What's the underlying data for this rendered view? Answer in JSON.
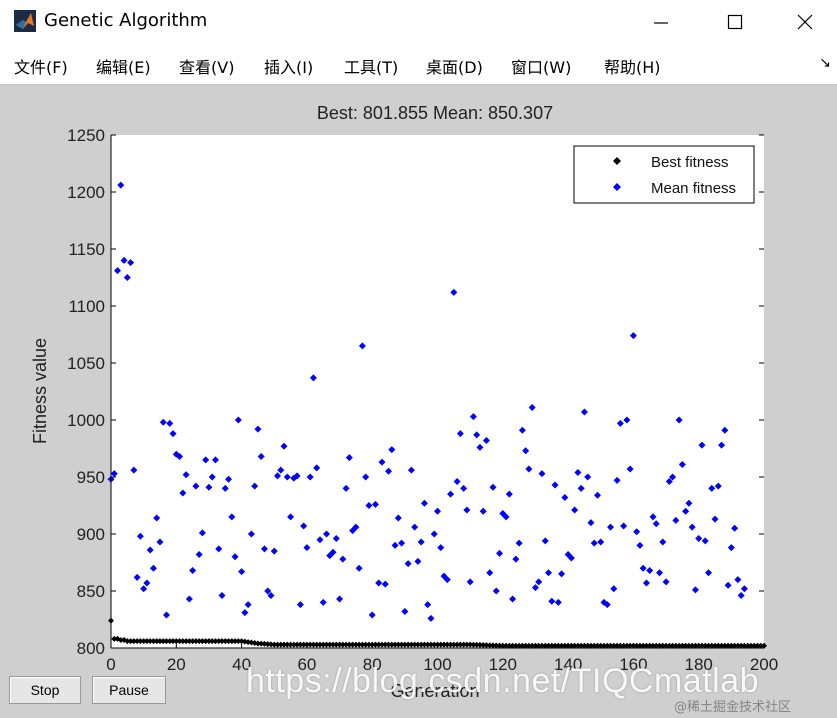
{
  "window": {
    "title": "Genetic Algorithm",
    "minimize_glyph": "—",
    "maximize_glyph": "☐",
    "close_glyph": "✕"
  },
  "menu": {
    "items": [
      {
        "label": "文件(F)"
      },
      {
        "label": "编辑(E)"
      },
      {
        "label": "查看(V)"
      },
      {
        "label": "插入(I)"
      },
      {
        "label": "工具(T)"
      },
      {
        "label": "桌面(D)"
      },
      {
        "label": "窗口(W)"
      },
      {
        "label": "帮助(H)"
      }
    ],
    "dock_glyph": "↘"
  },
  "buttons": {
    "stop": "Stop",
    "pause": "Pause"
  },
  "watermark": {
    "url": "https://blog.csdn.net/TIQCmatlab",
    "community": "@稀土掘金技术社区"
  },
  "colors": {
    "best": "#000000",
    "mean": "#0000ff",
    "figure_bg": "#cfcfcf",
    "axes_bg": "#ffffff"
  },
  "chart_data": {
    "type": "scatter",
    "title": "Best: 801.855 Mean: 850.307",
    "xlabel": "Generation",
    "ylabel": "Fitness value",
    "xlim": [
      0,
      200
    ],
    "ylim": [
      800,
      1250
    ],
    "xticks": [
      0,
      20,
      40,
      60,
      80,
      100,
      120,
      140,
      160,
      180,
      200
    ],
    "yticks": [
      800,
      850,
      900,
      950,
      1000,
      1050,
      1100,
      1150,
      1200,
      1250
    ],
    "legend": {
      "placement": "top-right",
      "entries": [
        "Best fitness",
        "Mean fitness"
      ]
    },
    "series": [
      {
        "name": "Best fitness",
        "marker": "diamond",
        "x": [
          0,
          1,
          2,
          3,
          4,
          5,
          6,
          7,
          8,
          9,
          10,
          12,
          14,
          16,
          18,
          20,
          25,
          30,
          35,
          40,
          45,
          50,
          60,
          70,
          80,
          90,
          100,
          110,
          120,
          130,
          140,
          150,
          160,
          170,
          180,
          190,
          200
        ],
        "values": [
          824,
          808,
          808,
          807,
          807,
          806,
          806,
          806,
          806,
          806,
          806,
          806,
          806,
          806,
          806,
          806,
          806,
          806,
          806,
          806,
          804,
          803,
          803,
          803,
          803,
          803,
          803,
          803,
          802,
          802,
          802,
          802,
          802,
          802,
          802,
          802,
          802
        ]
      },
      {
        "name": "Mean fitness",
        "marker": "diamond",
        "points": [
          [
            0,
            948
          ],
          [
            1,
            953
          ],
          [
            2,
            1131
          ],
          [
            3,
            1206
          ],
          [
            4,
            1140
          ],
          [
            5,
            1125
          ],
          [
            6,
            1138
          ],
          [
            7,
            956
          ],
          [
            8,
            862
          ],
          [
            9,
            898
          ],
          [
            10,
            852
          ],
          [
            11,
            857
          ],
          [
            12,
            886
          ],
          [
            13,
            870
          ],
          [
            14,
            914
          ],
          [
            15,
            893
          ],
          [
            16,
            998
          ],
          [
            17,
            829
          ],
          [
            18,
            997
          ],
          [
            19,
            988
          ],
          [
            20,
            970
          ],
          [
            21,
            968
          ],
          [
            22,
            936
          ],
          [
            23,
            952
          ],
          [
            24,
            843
          ],
          [
            25,
            868
          ],
          [
            26,
            942
          ],
          [
            27,
            882
          ],
          [
            28,
            901
          ],
          [
            29,
            965
          ],
          [
            30,
            941
          ],
          [
            31,
            950
          ],
          [
            32,
            965
          ],
          [
            33,
            887
          ],
          [
            34,
            846
          ],
          [
            35,
            940
          ],
          [
            36,
            948
          ],
          [
            37,
            915
          ],
          [
            38,
            880
          ],
          [
            39,
            1000
          ],
          [
            40,
            867
          ],
          [
            41,
            831
          ],
          [
            42,
            838
          ],
          [
            43,
            900
          ],
          [
            44,
            942
          ],
          [
            45,
            992
          ],
          [
            46,
            968
          ],
          [
            47,
            887
          ],
          [
            48,
            850
          ],
          [
            49,
            846
          ],
          [
            50,
            885
          ],
          [
            51,
            951
          ],
          [
            52,
            956
          ],
          [
            53,
            977
          ],
          [
            54,
            950
          ],
          [
            55,
            915
          ],
          [
            56,
            949
          ],
          [
            57,
            951
          ],
          [
            58,
            838
          ],
          [
            59,
            907
          ],
          [
            60,
            888
          ],
          [
            61,
            950
          ],
          [
            62,
            1037
          ],
          [
            63,
            958
          ],
          [
            64,
            895
          ],
          [
            65,
            840
          ],
          [
            66,
            900
          ],
          [
            67,
            881
          ],
          [
            68,
            884
          ],
          [
            69,
            896
          ],
          [
            70,
            843
          ],
          [
            71,
            878
          ],
          [
            72,
            940
          ],
          [
            73,
            967
          ],
          [
            74,
            903
          ],
          [
            75,
            906
          ],
          [
            76,
            870
          ],
          [
            77,
            1065
          ],
          [
            78,
            950
          ],
          [
            79,
            925
          ],
          [
            80,
            829
          ],
          [
            81,
            926
          ],
          [
            82,
            857
          ],
          [
            83,
            963
          ],
          [
            84,
            856
          ],
          [
            85,
            955
          ],
          [
            86,
            974
          ],
          [
            87,
            890
          ],
          [
            88,
            914
          ],
          [
            89,
            892
          ],
          [
            90,
            832
          ],
          [
            91,
            874
          ],
          [
            92,
            956
          ],
          [
            93,
            906
          ],
          [
            94,
            876
          ],
          [
            95,
            893
          ],
          [
            96,
            927
          ],
          [
            97,
            838
          ],
          [
            98,
            826
          ],
          [
            99,
            900
          ],
          [
            100,
            920
          ],
          [
            101,
            888
          ],
          [
            102,
            863
          ],
          [
            103,
            860
          ],
          [
            104,
            935
          ],
          [
            105,
            1112
          ],
          [
            106,
            946
          ],
          [
            107,
            988
          ],
          [
            108,
            940
          ],
          [
            109,
            921
          ],
          [
            110,
            858
          ],
          [
            111,
            1003
          ],
          [
            112,
            987
          ],
          [
            113,
            976
          ],
          [
            114,
            920
          ],
          [
            115,
            982
          ],
          [
            116,
            866
          ],
          [
            117,
            941
          ],
          [
            118,
            850
          ],
          [
            119,
            883
          ],
          [
            120,
            918
          ],
          [
            121,
            915
          ],
          [
            122,
            935
          ],
          [
            123,
            843
          ],
          [
            124,
            878
          ],
          [
            125,
            892
          ],
          [
            126,
            991
          ],
          [
            127,
            973
          ],
          [
            128,
            957
          ],
          [
            129,
            1011
          ],
          [
            130,
            853
          ],
          [
            131,
            858
          ],
          [
            132,
            953
          ],
          [
            133,
            894
          ],
          [
            134,
            866
          ],
          [
            135,
            841
          ],
          [
            136,
            943
          ],
          [
            137,
            840
          ],
          [
            138,
            865
          ],
          [
            139,
            932
          ],
          [
            140,
            882
          ],
          [
            141,
            879
          ],
          [
            142,
            921
          ],
          [
            143,
            954
          ],
          [
            144,
            940
          ],
          [
            145,
            1007
          ],
          [
            146,
            950
          ],
          [
            147,
            910
          ],
          [
            148,
            892
          ],
          [
            149,
            934
          ],
          [
            150,
            893
          ],
          [
            151,
            840
          ],
          [
            152,
            838
          ],
          [
            153,
            906
          ],
          [
            154,
            852
          ],
          [
            155,
            947
          ],
          [
            156,
            997
          ],
          [
            157,
            907
          ],
          [
            158,
            1000
          ],
          [
            159,
            957
          ],
          [
            160,
            1074
          ],
          [
            161,
            902
          ],
          [
            162,
            890
          ],
          [
            163,
            870
          ],
          [
            164,
            857
          ],
          [
            165,
            868
          ],
          [
            166,
            915
          ],
          [
            167,
            909
          ],
          [
            168,
            866
          ],
          [
            169,
            893
          ],
          [
            170,
            858
          ],
          [
            171,
            946
          ],
          [
            172,
            950
          ],
          [
            173,
            912
          ],
          [
            174,
            1000
          ],
          [
            175,
            961
          ],
          [
            176,
            920
          ],
          [
            177,
            927
          ],
          [
            178,
            906
          ],
          [
            179,
            851
          ],
          [
            180,
            896
          ],
          [
            181,
            978
          ],
          [
            182,
            894
          ],
          [
            183,
            866
          ],
          [
            184,
            940
          ],
          [
            185,
            913
          ],
          [
            186,
            942
          ],
          [
            187,
            978
          ],
          [
            188,
            991
          ],
          [
            189,
            855
          ],
          [
            190,
            888
          ],
          [
            191,
            905
          ],
          [
            192,
            860
          ],
          [
            193,
            846
          ],
          [
            194,
            852
          ]
        ]
      }
    ]
  }
}
